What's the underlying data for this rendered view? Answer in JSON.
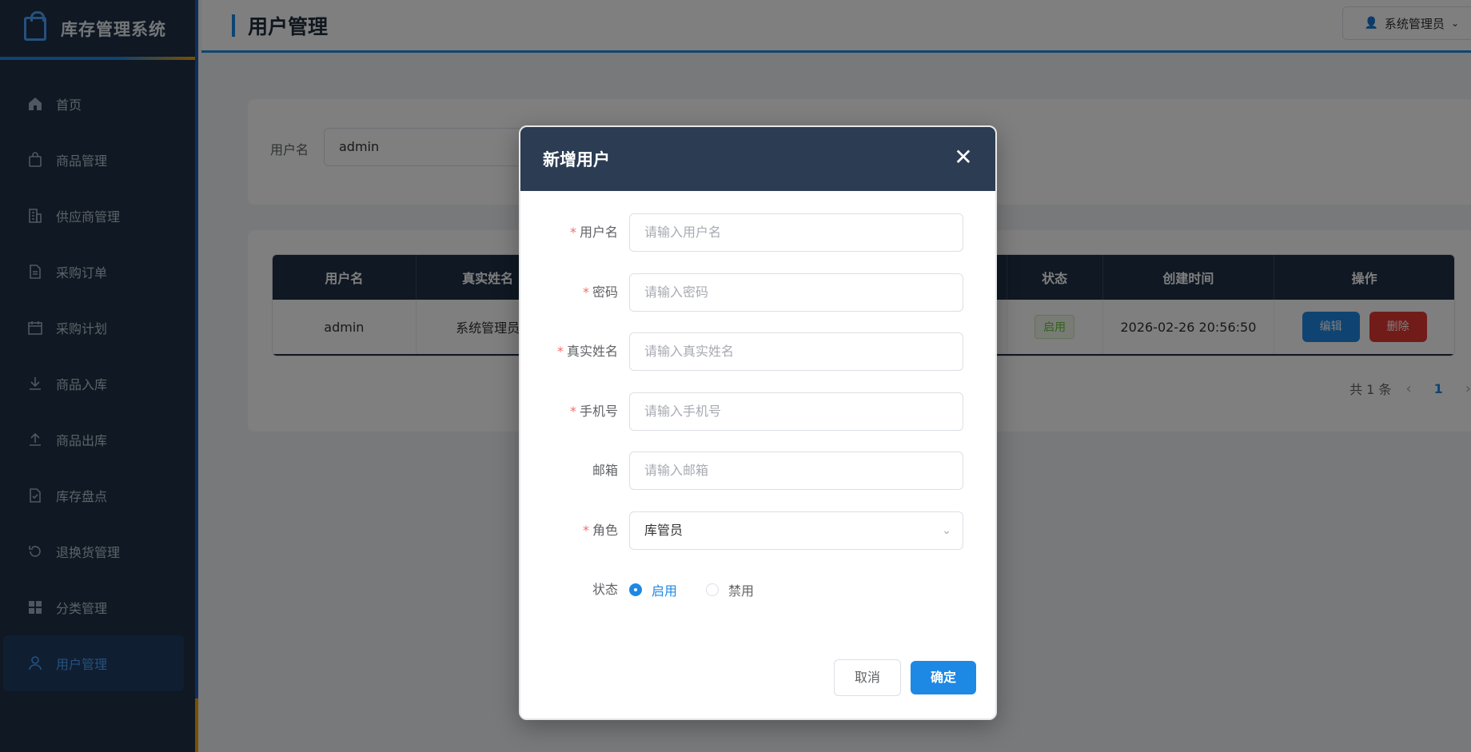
{
  "app": {
    "title": "库存管理系统"
  },
  "sidebar": {
    "items": [
      {
        "label": "首页",
        "icon": "home-icon"
      },
      {
        "label": "商品管理",
        "icon": "shopping-bag-icon"
      },
      {
        "label": "供应商管理",
        "icon": "building-icon"
      },
      {
        "label": "采购订单",
        "icon": "document-icon"
      },
      {
        "label": "采购计划",
        "icon": "calendar-icon"
      },
      {
        "label": "商品入库",
        "icon": "download-icon"
      },
      {
        "label": "商品出库",
        "icon": "upload-icon"
      },
      {
        "label": "库存盘点",
        "icon": "checklist-icon"
      },
      {
        "label": "退换货管理",
        "icon": "refresh-icon"
      },
      {
        "label": "分类管理",
        "icon": "grid-icon"
      },
      {
        "label": "用户管理",
        "icon": "user-icon",
        "active": true
      }
    ]
  },
  "header": {
    "title": "用户管理",
    "user": "系统管理员"
  },
  "search": {
    "label": "用户名",
    "value": "admin"
  },
  "table": {
    "headers": [
      "用户名",
      "真实姓名",
      "",
      "状态",
      "创建时间",
      "操作"
    ],
    "rows": [
      {
        "username": "admin",
        "realname": "系统管理员",
        "status": "启用",
        "created": "2026-02-26 20:56:50",
        "edit": "编辑",
        "delete": "删除"
      }
    ]
  },
  "pager": {
    "total": "共 1 条",
    "current": "1"
  },
  "dialog": {
    "title": "新增用户",
    "fields": {
      "username": {
        "label": "用户名",
        "placeholder": "请输入用户名",
        "required": true
      },
      "password": {
        "label": "密码",
        "placeholder": "请输入密码",
        "required": true
      },
      "realname": {
        "label": "真实姓名",
        "placeholder": "请输入真实姓名",
        "required": true
      },
      "phone": {
        "label": "手机号",
        "placeholder": "请输入手机号",
        "required": true
      },
      "email": {
        "label": "邮箱",
        "placeholder": "请输入邮箱",
        "required": false
      },
      "role": {
        "label": "角色",
        "value": "库管员",
        "required": true
      },
      "status": {
        "label": "状态",
        "options": [
          "启用",
          "禁用"
        ],
        "selected": "启用"
      }
    },
    "cancel": "取消",
    "confirm": "确定"
  },
  "colors": {
    "accent": "#1e88e5",
    "sidebar": "#1f3146",
    "danger": "#e53935",
    "success": "#67c23a"
  }
}
